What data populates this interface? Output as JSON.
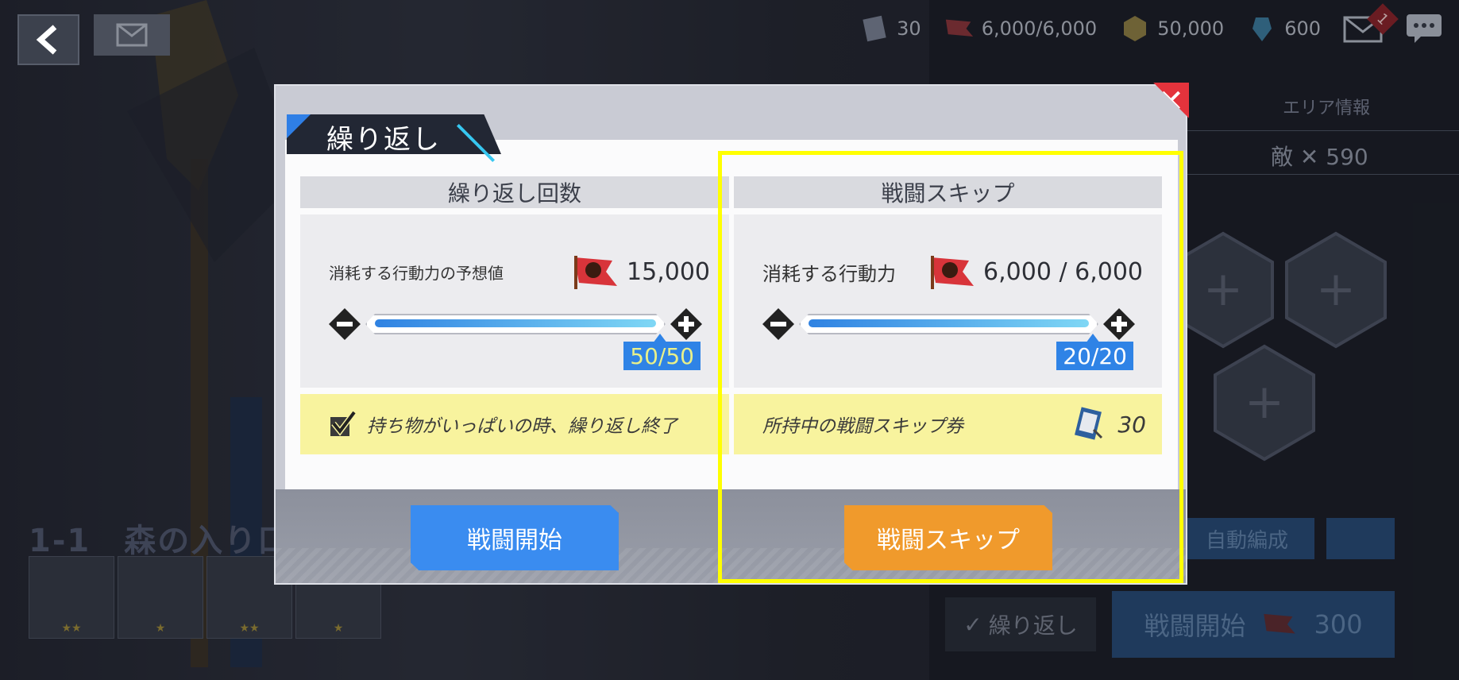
{
  "topbar": {
    "tickets": "30",
    "stamina": "6,000/6,000",
    "gold": "50,000",
    "gems": "600",
    "mail_badge": "1"
  },
  "background": {
    "area_info": "エリア情報",
    "enemy_count": "敵 ✕ 590",
    "stage_title": "1-1　森の入り口",
    "auto_formation": "自動編成",
    "repeat_label": "繰り返し",
    "start_label": "戦闘開始",
    "start_cost": "300",
    "item_stars": [
      "★★",
      "★",
      "★★",
      "★"
    ]
  },
  "modal": {
    "tab_title": "繰り返し",
    "close_icon": "✕",
    "left": {
      "header": "繰り返し回数",
      "cost_label": "消耗する行動力の予想値",
      "cost_value": "15,000",
      "count": "50/50",
      "note": "持ち物がいっぱいの時、繰り返し終了"
    },
    "right": {
      "header": "戦闘スキップ",
      "cost_label": "消耗する行動力",
      "cost_value": "6,000 / 6,000",
      "count": "20/20",
      "note": "所持中の戦闘スキップ券",
      "ticket_count": "30"
    },
    "start_button": "戦闘開始",
    "skip_button": "戦闘スキップ"
  },
  "colors": {
    "accent_blue": "#3a8cf0",
    "accent_orange": "#f09a2c",
    "close_red": "#e4333c",
    "highlight": "#ffff00",
    "note_yellow": "#f8f39e"
  }
}
